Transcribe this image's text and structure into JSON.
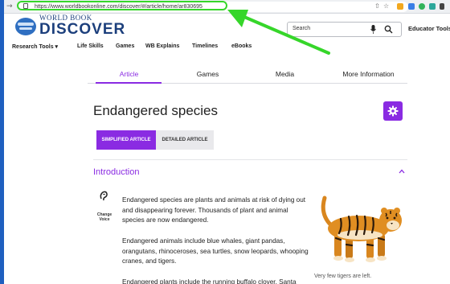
{
  "browser": {
    "url": "https://www.worldbookonline.com/discover/#/article/home/ar830695",
    "back_glyph": "→",
    "share_glyph": "⇧",
    "star_glyph": "☆"
  },
  "header": {
    "logo_top": "WORLD BOOK",
    "logo_main": "DISCOVER",
    "search_placeholder": "Search",
    "educator_tools": "Educator Tools"
  },
  "nav": [
    {
      "label": "Research Tools ▾"
    },
    {
      "label": "Life Skills"
    },
    {
      "label": "Games"
    },
    {
      "label": "WB Explains"
    },
    {
      "label": "Timelines"
    },
    {
      "label": "eBooks"
    }
  ],
  "tabs": [
    {
      "label": "Article",
      "active": true
    },
    {
      "label": "Games"
    },
    {
      "label": "Media"
    },
    {
      "label": "More Information"
    }
  ],
  "article": {
    "title": "Endangered species",
    "simplified_label": "SIMPLIFIED ARTICLE",
    "detailed_label": "DETAILED ARTICLE",
    "section_title": "Introduction",
    "change_voice": "Change Voice",
    "paragraphs": [
      "Endangered species are plants and animals at risk of dying out and disappearing forever. Thousands of plant and animal species are now endangered.",
      "Endangered animals include blue whales, giant pandas, orangutans, rhinoceroses, sea turtles, snow leopards, whooping cranes, and tigers.",
      "Endangered plants include the running buffalo clover, Santa"
    ],
    "image_caption": "Very few tigers are left."
  },
  "colors": {
    "accent": "#8a2be2",
    "brand": "#1c3f7c",
    "annotation": "#36d62a",
    "desktop": "#1f5fbf"
  }
}
